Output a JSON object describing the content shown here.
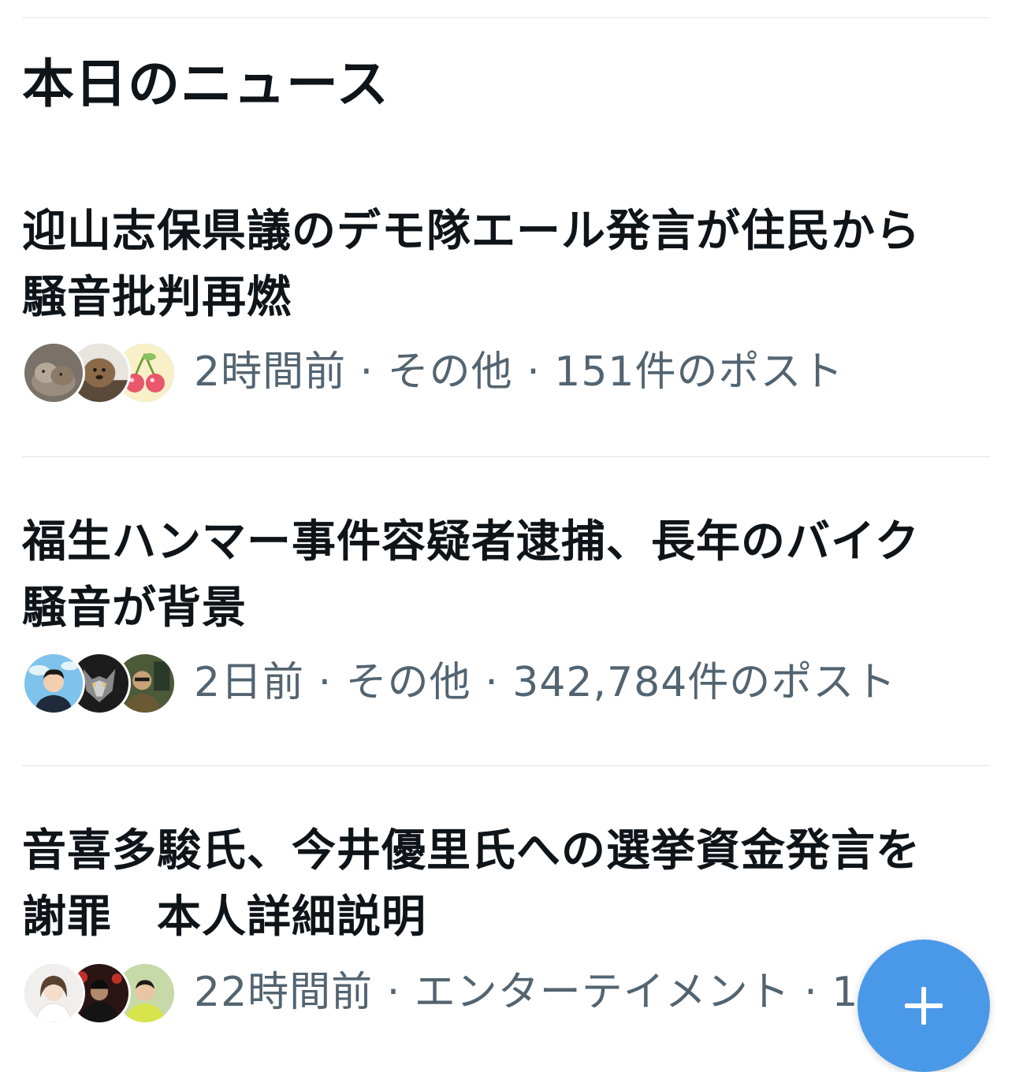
{
  "section": {
    "title": "本日のニュース"
  },
  "news": [
    {
      "headline": "迎山志保県議のデモ隊エール発言が住民から騒音批判再燃",
      "meta": "2時間前 · その他 · 151件のポスト",
      "avatars": [
        "dog-photo-avatar",
        "dog-photo-avatar",
        "cherry-illustration-avatar"
      ]
    },
    {
      "headline": "福生ハンマー事件容疑者逮捕、長年のバイク騒音が背景",
      "meta": "2日前 · その他 · 342,784件のポスト",
      "avatars": [
        "man-portrait-avatar",
        "wolf-photo-avatar",
        "person-photo-avatar"
      ]
    },
    {
      "headline": "音喜多駿氏、今井優里氏への選挙資金発言を謝罪　本人詳細説明",
      "meta": "22時間前 · エンターテイメント · 1",
      "avatars": [
        "woman-portrait-avatar",
        "person-dark-avatar",
        "man-outdoor-avatar"
      ]
    }
  ],
  "fab": {
    "icon": "plus-icon"
  },
  "colors": {
    "text_primary": "#0f1419",
    "text_secondary": "#536471",
    "divider": "#e1e4e7",
    "accent": "#4a99e9"
  }
}
